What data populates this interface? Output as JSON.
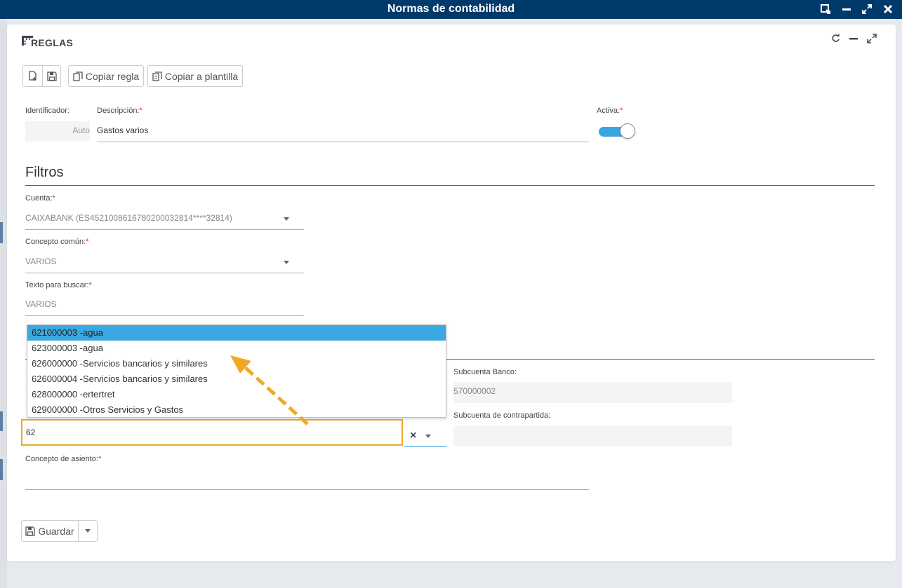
{
  "window": {
    "title": "Normas de contabilidad"
  },
  "panel": {
    "title": "REGLAS"
  },
  "toolbar": {
    "copy_rule_label": "Copiar regla",
    "copy_template_label": "Copiar a plantilla"
  },
  "form": {
    "identifier": {
      "label": "Identificador:",
      "value": "Auto"
    },
    "description": {
      "label": "Descripción:",
      "value": "Gastos varios"
    },
    "active": {
      "label": "Activa:",
      "value": true
    },
    "required_mark": "*"
  },
  "filters": {
    "title": "Filtros",
    "account": {
      "label": "Cuenta:",
      "value": "CAIXABANK (ES4521008616780200032814****32814)"
    },
    "common_concept": {
      "label": "Concepto común:",
      "value": "VARIOS"
    },
    "search_text": {
      "label": "Texto para buscar:",
      "value": "VARIOS"
    }
  },
  "accounting": {
    "bank_subaccount": {
      "label": "Subcuenta Banco:",
      "value": "570000002"
    },
    "counterpart_subaccount": {
      "label": "Subcuenta de contrapartida:",
      "value": ""
    },
    "entry_concept": {
      "label": "Concepto de asiento:",
      "value": ""
    },
    "subaccount_search": {
      "value": "62",
      "clear_symbol": "×"
    }
  },
  "dropdown": {
    "options": [
      {
        "label": "621000003 -agua",
        "selected": true
      },
      {
        "label": "623000003 -agua",
        "selected": false
      },
      {
        "label": "626000000 -Servicios bancarios y similares",
        "selected": false
      },
      {
        "label": "626000004 -Servicios bancarios y similares",
        "selected": false
      },
      {
        "label": "628000000 -ertertret",
        "selected": false
      },
      {
        "label": "629000000 -Otros Servicios y Gastos",
        "selected": false
      }
    ]
  },
  "footer": {
    "save_label": "Guardar"
  },
  "colors": {
    "titlebar": "#003a6b",
    "highlight": "#3aa8e1",
    "annotation": "#f0a925",
    "toggle_on": "#38a6e0",
    "required": "#d9263b"
  }
}
